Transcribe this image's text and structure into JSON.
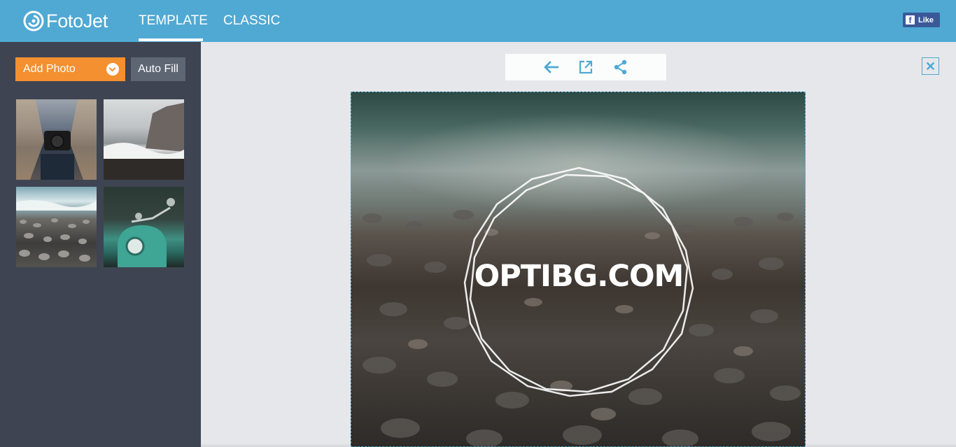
{
  "header": {
    "logo_text": "FotoJet",
    "tabs": [
      {
        "label": "TEMPLATE",
        "active": true
      },
      {
        "label": "CLASSIC",
        "active": false
      }
    ],
    "fb_like_label": "Like"
  },
  "sidebar": {
    "add_photo_label": "Add Photo",
    "auto_fill_label": "Auto Fill",
    "thumbnails": [
      {
        "subject": "person holding camera"
      },
      {
        "subject": "waves at rocky coast"
      },
      {
        "subject": "pebble beach"
      },
      {
        "subject": "mint scooter"
      }
    ]
  },
  "toolbar": {
    "icons": [
      "back-arrow-icon",
      "open-external-icon",
      "share-icon"
    ]
  },
  "canvas": {
    "text": "OPTIBG.COM"
  },
  "colors": {
    "header_bg": "#4fa9d3",
    "sidebar_bg": "#3e4452",
    "accent_orange": "#f4902f",
    "workspace_bg": "#e5e7ea"
  }
}
